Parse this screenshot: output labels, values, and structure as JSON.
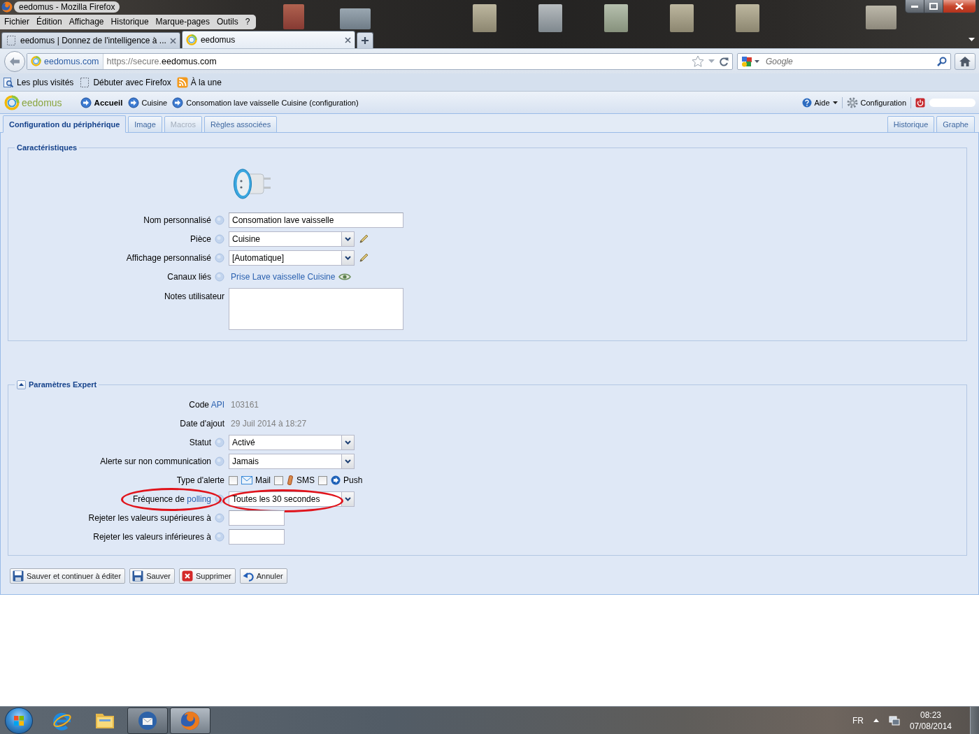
{
  "window": {
    "title": "eedomus - Mozilla Firefox"
  },
  "menu_bar": {
    "items": [
      "Fichier",
      "Édition",
      "Affichage",
      "Historique",
      "Marque-pages",
      "Outils",
      "?"
    ]
  },
  "browser_tabs": [
    {
      "title": "eedomus | Donnez de l'intelligence à ...",
      "kind": "blank",
      "selected": false
    },
    {
      "title": "eedomus",
      "kind": "site",
      "selected": true
    }
  ],
  "nav_bar": {
    "site_identity": "eedomus.com",
    "url": {
      "prefix": "https://secure.",
      "domain": "eedomus.com"
    },
    "search": {
      "placeholder": "Google"
    }
  },
  "bookmarks_bar": [
    {
      "label": "Les plus visités",
      "kind": "smart"
    },
    {
      "label": "Débuter avec Firefox",
      "kind": "page"
    },
    {
      "label": "À la une",
      "kind": "feed"
    }
  ],
  "app_header": {
    "logo": "eedomus",
    "breadcrumb": [
      {
        "label": "Accueil",
        "kind": "home"
      },
      {
        "label": "Cuisine",
        "kind": "page"
      },
      {
        "label": "Consomation lave vaisselle Cuisine (configuration)",
        "kind": "page"
      }
    ],
    "menu": [
      {
        "label": "Aide",
        "kind": "help"
      },
      {
        "label": "Configuration",
        "kind": "settings"
      }
    ]
  },
  "page_tabs": {
    "left": [
      {
        "label": "Configuration du périphérique",
        "selected": true,
        "disabled": false
      },
      {
        "label": "Image",
        "selected": false,
        "disabled": false
      },
      {
        "label": "Macros",
        "selected": false,
        "disabled": true
      },
      {
        "label": "Règles associées",
        "selected": false,
        "disabled": false
      }
    ],
    "right": [
      {
        "label": "Historique",
        "selected": false,
        "disabled": false
      },
      {
        "label": "Graphe",
        "selected": false,
        "disabled": false
      }
    ]
  },
  "sections": [
    {
      "title": "Caractéristiques",
      "collapsible": false,
      "rows": [
        {
          "kind": "device_image"
        },
        {
          "kind": "text",
          "label": "Nom personnalisé",
          "help": true,
          "circled": false,
          "value": "Consomation lave vaisselle"
        },
        {
          "kind": "select",
          "label": "Pièce",
          "help": true,
          "circled": false,
          "value": "Cuisine",
          "editable": true
        },
        {
          "kind": "select",
          "label": "Affichage personnalisé",
          "help": true,
          "circled": false,
          "value": "[Automatique]",
          "editable": true
        },
        {
          "kind": "link",
          "label": "Canaux liés",
          "help": true,
          "circled": false,
          "value": "Prise Lave vaisselle Cuisine"
        },
        {
          "kind": "textarea",
          "label": "Notes utilisateur",
          "help": false,
          "circled": false
        }
      ]
    },
    {
      "title": "Paramètres Expert",
      "collapsible": true,
      "expanded": true,
      "rows": [
        {
          "kind": "static",
          "label": "Code",
          "label_link": "API",
          "help": false,
          "circled": false,
          "value": "103161"
        },
        {
          "kind": "static",
          "label": "Date d'ajout",
          "help": false,
          "circled": false,
          "value": "29 Juil 2014 à 18:27"
        },
        {
          "kind": "select",
          "label": "Statut",
          "help": true,
          "circled": false,
          "value": "Activé",
          "editable": false
        },
        {
          "kind": "select",
          "label": "Alerte sur non communication",
          "help": true,
          "circled": false,
          "value": "Jamais",
          "editable": false
        },
        {
          "kind": "checkboxes",
          "label": "Type d'alerte",
          "help": false,
          "circled": false,
          "options": [
            {
              "label": "Mail",
              "kind": "mail",
              "checked": false
            },
            {
              "label": "SMS",
              "kind": "sms",
              "checked": false
            },
            {
              "label": "Push",
              "kind": "push",
              "checked": false
            }
          ]
        },
        {
          "kind": "select",
          "label": "Fréquence de",
          "label_link": "polling",
          "help": true,
          "circled": true,
          "value": "Toutes les 30 secondes",
          "editable": false
        },
        {
          "kind": "short_text",
          "label": "Rejeter les valeurs supérieures à",
          "help": true,
          "circled": false
        },
        {
          "kind": "short_text",
          "label": "Rejeter les valeurs inférieures à",
          "help": true,
          "circled": false
        }
      ]
    }
  ],
  "actions": [
    {
      "label": "Sauver et continuer à éditer",
      "kind": "save"
    },
    {
      "label": "Sauver",
      "kind": "save"
    },
    {
      "label": "Supprimer",
      "kind": "delete"
    },
    {
      "label": "Annuler",
      "kind": "undo"
    }
  ],
  "taskbar": {
    "apps": [
      {
        "kind": "browser_e",
        "running": false,
        "selected": false
      },
      {
        "kind": "folder",
        "running": false,
        "selected": false
      },
      {
        "kind": "mail",
        "running": true,
        "selected": false
      },
      {
        "kind": "browser_fox",
        "running": true,
        "selected": true
      }
    ],
    "language": "FR",
    "time": "08:23",
    "date": "07/08/2014"
  }
}
